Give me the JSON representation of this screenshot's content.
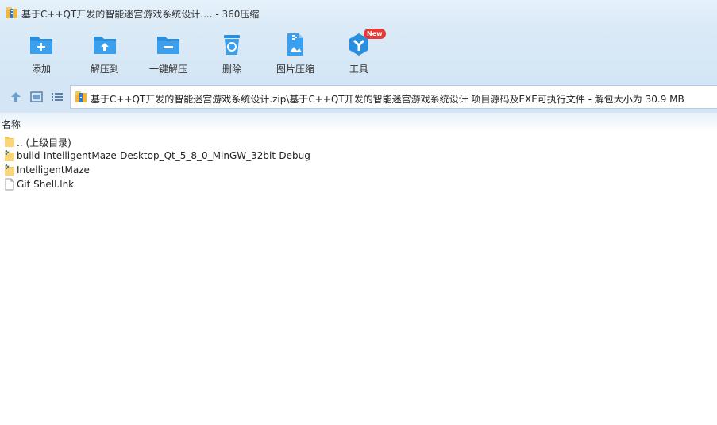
{
  "window": {
    "title": "基于C++QT开发的智能迷宫游戏系统设计.... - 360压缩"
  },
  "toolbar": {
    "items": [
      {
        "label": "添加",
        "icon": "add-icon"
      },
      {
        "label": "解压到",
        "icon": "extract-to-icon"
      },
      {
        "label": "一键解压",
        "icon": "one-click-extract-icon"
      },
      {
        "label": "删除",
        "icon": "delete-icon"
      },
      {
        "label": "图片压缩",
        "icon": "image-compress-icon"
      },
      {
        "label": "工具",
        "icon": "tools-icon",
        "badge": "New"
      }
    ]
  },
  "address": {
    "path": "基于C++QT开发的智能迷宫游戏系统设计.zip\\基于C++QT开发的智能迷宫游戏系统设计 项目源码及EXE可执行文件 - 解包大小为 30.9 MB"
  },
  "list": {
    "column_name": "名称",
    "items": [
      {
        "name": ".. (上级目录)",
        "type": "folder"
      },
      {
        "name": "build-IntelligentMaze-Desktop_Qt_5_8_0_MinGW_32bit-Debug",
        "type": "folder-zip"
      },
      {
        "name": "IntelligentMaze",
        "type": "folder-zip"
      },
      {
        "name": "Git Shell.lnk",
        "type": "file"
      }
    ]
  },
  "colors": {
    "accent": "#2b8fe0",
    "toolbar_bg": "#d4e6f5",
    "badge": "#e53935"
  }
}
